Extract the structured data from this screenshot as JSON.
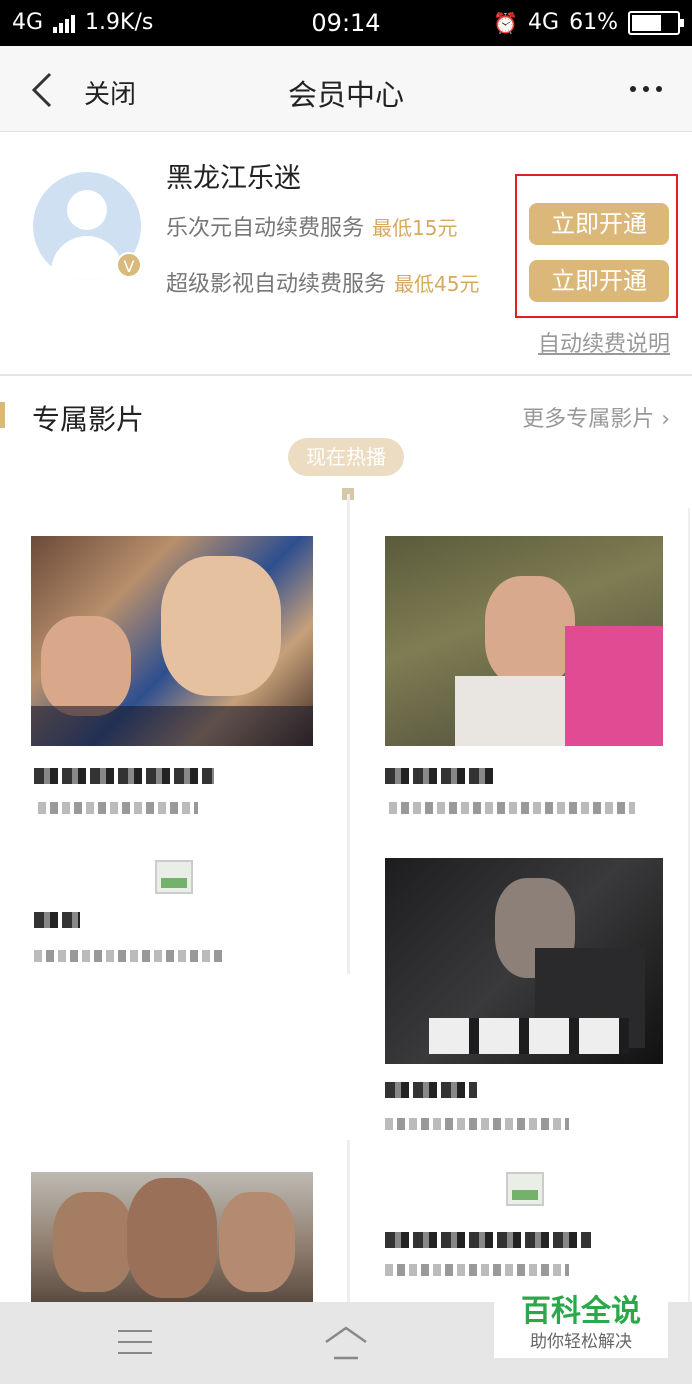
{
  "status_bar": {
    "network_left": "4G",
    "speed": "1.9K/s",
    "time": "09:14",
    "network_right": "4G",
    "battery": "61%"
  },
  "nav": {
    "close_label": "关闭",
    "title": "会员中心",
    "back_icon": "chevron-left-icon",
    "more_icon": "more-dots-icon"
  },
  "member": {
    "username": "黑龙江乐迷",
    "services": [
      {
        "name": "乐次元自动续费服务",
        "price": "最低15元",
        "button": "立即开通"
      },
      {
        "name": "超级影视自动续费服务",
        "price": "最低45元",
        "button": "立即开通"
      }
    ],
    "auto_renew_link": "自动续费说明",
    "vip_badge": "V"
  },
  "section": {
    "title": "专属影片",
    "more": "更多专属影片 ›",
    "timeline_badge": "现在热播"
  },
  "watermark": {
    "main": "百科全说",
    "sub": "助你轻松解决"
  },
  "colors": {
    "accent_gold": "#dbb779",
    "price_gold": "#d7a95e",
    "highlight_red": "#e02020",
    "watermark_green": "#2aa84a"
  }
}
